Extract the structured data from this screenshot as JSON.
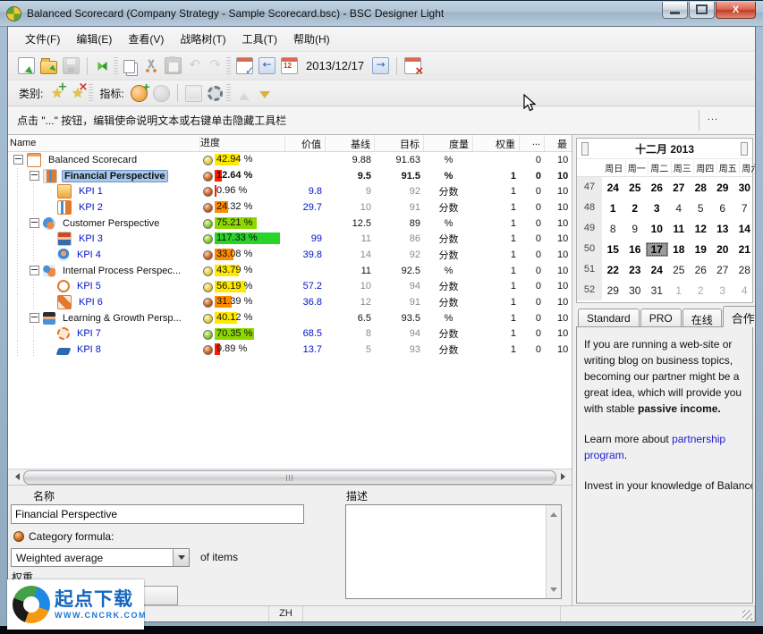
{
  "window": {
    "title": "Balanced Scorecard (Company Strategy - Sample Scorecard.bsc) - BSC Designer Light"
  },
  "menu": {
    "items": [
      "文件(F)",
      "编辑(E)",
      "查看(V)",
      "战略树(T)",
      "工具(T)",
      "帮助(H)"
    ]
  },
  "toolbar1": [
    {
      "type": "icon",
      "name": "new-file-icon"
    },
    {
      "type": "icon",
      "name": "open-folder-icon"
    },
    {
      "type": "icon",
      "name": "save-icon",
      "disabled": true
    },
    {
      "type": "sep"
    },
    {
      "type": "icon",
      "name": "strategy-map-icon"
    },
    {
      "type": "grip"
    },
    {
      "type": "icon",
      "name": "copy-icon"
    },
    {
      "type": "icon",
      "name": "cut-icon"
    },
    {
      "type": "icon",
      "name": "paste-icon",
      "disabled": true
    },
    {
      "type": "icon",
      "name": "undo-icon",
      "glyph": "↶",
      "disabled": true
    },
    {
      "type": "icon",
      "name": "redo-icon",
      "glyph": "↷",
      "disabled": true
    },
    {
      "type": "grip"
    },
    {
      "type": "icon",
      "name": "calendar-check-icon"
    },
    {
      "type": "icon",
      "name": "prev-date-icon",
      "glyph": "←"
    },
    {
      "type": "icon",
      "name": "calendar-date-icon"
    },
    {
      "type": "date",
      "value": "2013/12/17",
      "name": "toolbar-date"
    },
    {
      "type": "icon",
      "name": "next-date-icon",
      "glyph": "→"
    },
    {
      "type": "sep"
    },
    {
      "type": "icon",
      "name": "calendar-remove-icon"
    }
  ],
  "toolbar2": [
    {
      "type": "label",
      "text": "类别:"
    },
    {
      "type": "icon",
      "name": "star-add-icon",
      "glyph": "★"
    },
    {
      "type": "icon",
      "name": "star-remove-icon",
      "glyph": "★"
    },
    {
      "type": "grip"
    },
    {
      "type": "label",
      "text": "指标:"
    },
    {
      "type": "icon",
      "name": "kpi-add-icon"
    },
    {
      "type": "icon",
      "name": "kpi-remove-icon",
      "disabled": true
    },
    {
      "type": "sep"
    },
    {
      "type": "icon",
      "name": "chart-icon",
      "disabled": true
    },
    {
      "type": "icon",
      "name": "gear-icon"
    },
    {
      "type": "grip"
    },
    {
      "type": "icon",
      "name": "move-up-icon",
      "disabled": true
    },
    {
      "type": "icon",
      "name": "move-down-icon"
    }
  ],
  "hint": {
    "text": "点击 \"...\" 按钮，编辑使命说明文本或右键单击隐藏工具栏",
    "more_label": "..."
  },
  "table": {
    "columns": [
      "Name",
      "进度",
      "价值",
      "基线",
      "目标",
      "度量",
      "权重",
      "...",
      "最"
    ],
    "rows": [
      {
        "level": 0,
        "group": true,
        "icon": "scorecard",
        "name": "Balanced Scorecard",
        "pct": "42.94 %",
        "pctv": 42.94,
        "bar": "yellow",
        "circle": "yellow",
        "value": "",
        "baseline": "9.88",
        "target": "91.63",
        "measure": "%",
        "weight": "",
        "dots": "0",
        "max": "10",
        "selected": false,
        "bold": false
      },
      {
        "level": 1,
        "group": true,
        "icon": "financial",
        "name": "Financial Perspective",
        "pct": "12.64 %",
        "pctv": 12.64,
        "bar": "red",
        "circle": "red",
        "value": "",
        "baseline": "9.5",
        "target": "91.5",
        "measure": "%",
        "weight": "1",
        "dots": "0",
        "max": "10",
        "selected": true,
        "bold": true
      },
      {
        "level": 2,
        "group": false,
        "icon": "kpi1",
        "name": "KPI 1",
        "pct": "0.96 %",
        "pctv": 0.96,
        "bar": "red",
        "circle": "red",
        "value": "9.8",
        "baseline": "9",
        "target": "92",
        "measure": "分数",
        "weight": "1",
        "dots": "0",
        "max": "10",
        "selected": false,
        "bold": false
      },
      {
        "level": 2,
        "group": false,
        "icon": "kpi2",
        "name": "KPI 2",
        "pct": "24.32 %",
        "pctv": 24.32,
        "bar": "orange",
        "circle": "red",
        "value": "29.7",
        "baseline": "10",
        "target": "91",
        "measure": "分数",
        "weight": "1",
        "dots": "0",
        "max": "10",
        "selected": false,
        "bold": false
      },
      {
        "level": 1,
        "group": true,
        "icon": "customer",
        "name": "Customer Perspective",
        "pct": "75.21 %",
        "pctv": 75.21,
        "bar": "green",
        "circle": "green",
        "value": "",
        "baseline": "12.5",
        "target": "89",
        "measure": "%",
        "weight": "1",
        "dots": "0",
        "max": "10",
        "selected": false,
        "bold": false
      },
      {
        "level": 2,
        "group": false,
        "icon": "kpi3",
        "name": "KPI 3",
        "pct": "117.33 %",
        "pctv": 117.33,
        "bar": "bgreen",
        "circle": "green",
        "value": "99",
        "baseline": "11",
        "target": "86",
        "measure": "分数",
        "weight": "1",
        "dots": "0",
        "max": "10",
        "selected": false,
        "bold": false
      },
      {
        "level": 2,
        "group": false,
        "icon": "kpi4",
        "name": "KPI 4",
        "pct": "33.08 %",
        "pctv": 33.08,
        "bar": "orange",
        "circle": "red",
        "value": "39.8",
        "baseline": "14",
        "target": "92",
        "measure": "分数",
        "weight": "1",
        "dots": "0",
        "max": "10",
        "selected": false,
        "bold": false
      },
      {
        "level": 1,
        "group": true,
        "icon": "internal",
        "name": "Internal Process Perspec...",
        "pct": "43.79 %",
        "pctv": 43.79,
        "bar": "yellow",
        "circle": "yellow",
        "value": "",
        "baseline": "11",
        "target": "92.5",
        "measure": "%",
        "weight": "1",
        "dots": "0",
        "max": "10",
        "selected": false,
        "bold": false
      },
      {
        "level": 2,
        "group": false,
        "icon": "kpi5",
        "name": "KPI 5",
        "pct": "56.19 %",
        "pctv": 56.19,
        "bar": "yellow",
        "circle": "yellow",
        "value": "57.2",
        "baseline": "10",
        "target": "94",
        "measure": "分数",
        "weight": "1",
        "dots": "0",
        "max": "10",
        "selected": false,
        "bold": false
      },
      {
        "level": 2,
        "group": false,
        "icon": "kpi6",
        "name": "KPI 6",
        "pct": "31.39 %",
        "pctv": 31.39,
        "bar": "orange",
        "circle": "red",
        "value": "36.8",
        "baseline": "12",
        "target": "91",
        "measure": "分数",
        "weight": "1",
        "dots": "0",
        "max": "10",
        "selected": false,
        "bold": false
      },
      {
        "level": 1,
        "group": true,
        "icon": "learning",
        "name": "Learning & Growth Persp...",
        "pct": "40.12 %",
        "pctv": 40.12,
        "bar": "yellow",
        "circle": "yellow",
        "value": "",
        "baseline": "6.5",
        "target": "93.5",
        "measure": "%",
        "weight": "1",
        "dots": "0",
        "max": "10",
        "selected": false,
        "bold": false
      },
      {
        "level": 2,
        "group": false,
        "icon": "kpi7",
        "name": "KPI 7",
        "pct": "70.35 %",
        "pctv": 70.35,
        "bar": "green",
        "circle": "green",
        "value": "68.5",
        "baseline": "8",
        "target": "94",
        "measure": "分数",
        "weight": "1",
        "dots": "0",
        "max": "10",
        "selected": false,
        "bold": false
      },
      {
        "level": 2,
        "group": false,
        "icon": "kpi8",
        "name": "KPI 8",
        "pct": "9.89 %",
        "pctv": 9.89,
        "bar": "red",
        "circle": "red",
        "value": "13.7",
        "baseline": "5",
        "target": "93",
        "measure": "分数",
        "weight": "1",
        "dots": "0",
        "max": "10",
        "selected": false,
        "bold": false
      }
    ]
  },
  "calendar": {
    "title": "十二月 2013",
    "day_headers": [
      "周日",
      "周一",
      "周二",
      "周三",
      "周四",
      "周五",
      "周六"
    ],
    "weeks": [
      {
        "num": 47,
        "days": [
          {
            "d": 24,
            "s": "b"
          },
          {
            "d": 25,
            "s": "b"
          },
          {
            "d": 26,
            "s": "b"
          },
          {
            "d": 27,
            "s": "b"
          },
          {
            "d": 28,
            "s": "b"
          },
          {
            "d": 29,
            "s": "b"
          },
          {
            "d": 30,
            "s": "b"
          }
        ]
      },
      {
        "num": 48,
        "days": [
          {
            "d": 1,
            "s": "b"
          },
          {
            "d": 2,
            "s": "b"
          },
          {
            "d": 3,
            "s": "b"
          },
          {
            "d": 4,
            "s": "n"
          },
          {
            "d": 5,
            "s": "n"
          },
          {
            "d": 6,
            "s": "n"
          },
          {
            "d": 7,
            "s": "n"
          }
        ]
      },
      {
        "num": 49,
        "days": [
          {
            "d": 8,
            "s": "n"
          },
          {
            "d": 9,
            "s": "n"
          },
          {
            "d": 10,
            "s": "b"
          },
          {
            "d": 11,
            "s": "b"
          },
          {
            "d": 12,
            "s": "b"
          },
          {
            "d": 13,
            "s": "b"
          },
          {
            "d": 14,
            "s": "b"
          }
        ]
      },
      {
        "num": 50,
        "days": [
          {
            "d": 15,
            "s": "b"
          },
          {
            "d": 16,
            "s": "b"
          },
          {
            "d": 17,
            "s": "sel"
          },
          {
            "d": 18,
            "s": "b"
          },
          {
            "d": 19,
            "s": "b"
          },
          {
            "d": 20,
            "s": "b"
          },
          {
            "d": 21,
            "s": "b"
          }
        ]
      },
      {
        "num": 51,
        "days": [
          {
            "d": 22,
            "s": "b"
          },
          {
            "d": 23,
            "s": "b"
          },
          {
            "d": 24,
            "s": "b"
          },
          {
            "d": 25,
            "s": "n"
          },
          {
            "d": 26,
            "s": "n"
          },
          {
            "d": 27,
            "s": "n"
          },
          {
            "d": 28,
            "s": "n"
          }
        ]
      },
      {
        "num": 52,
        "days": [
          {
            "d": 29,
            "s": "n"
          },
          {
            "d": 30,
            "s": "n"
          },
          {
            "d": 31,
            "s": "n"
          },
          {
            "d": 1,
            "s": "g"
          },
          {
            "d": 2,
            "s": "g"
          },
          {
            "d": 3,
            "s": "g"
          },
          {
            "d": 4,
            "s": "g"
          }
        ]
      }
    ]
  },
  "tabs": [
    {
      "label": "Standard",
      "active": false
    },
    {
      "label": "PRO",
      "active": false
    },
    {
      "label": "在线",
      "active": false
    },
    {
      "label": "合作伙伴",
      "active": true
    }
  ],
  "partner_panel": {
    "p1_normal": "If you are running a web-site or writing blog on business topics, becoming our partner might be a great idea, which will provide you with stable ",
    "p1_bold": "passive income.",
    "p2_prefix": "Learn more about ",
    "p2_link": "partnership program",
    "p2_suffix": ".",
    "p3": "Invest in your knowledge of Balanced Scc"
  },
  "bottom": {
    "name_label": "名称",
    "name_value": "Financial Perspective",
    "formula_label": "Category formula:",
    "formula_value": "Weighted average",
    "of_items_label": "of items",
    "weight_label": "权重",
    "desc_label": "描述"
  },
  "status": {
    "lang": "ZH"
  },
  "watermark": {
    "title": "起点下载",
    "url": "WWW.CNCRK.COM"
  },
  "colors": {
    "progress_yellow": "#ffe900",
    "progress_orange": "#ff8a00",
    "progress_red": "#ff1c00",
    "progress_green": "#8cd800",
    "progress_bright_green": "#28d428",
    "selection": "#a8c7ec",
    "kpi_text": "#0014c8"
  }
}
